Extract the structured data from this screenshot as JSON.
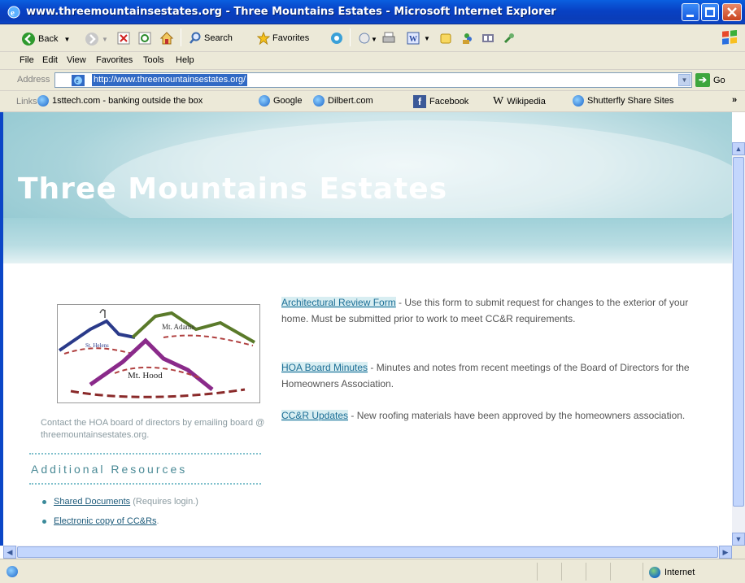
{
  "window": {
    "title": "www.threemountainsestates.org - Three Mountains Estates  - Microsoft Internet Explorer"
  },
  "toolbar": {
    "back_label": "Back",
    "search_label": "Search",
    "favorites_label": "Favorites"
  },
  "menu": [
    "File",
    "Edit",
    "View",
    "Favorites",
    "Tools",
    "Help"
  ],
  "address": {
    "label": "Address",
    "url": "http://www.threemountainsestates.org/",
    "go_label": "Go"
  },
  "links": {
    "label": "Links",
    "items": [
      "1sttech.com - banking outside the box",
      "Google",
      "Dilbert.com",
      "Facebook",
      "Wikipedia",
      "Shutterfly  Share Sites"
    ]
  },
  "page": {
    "site_title": "Three Mountains Estates",
    "logo_labels": [
      "St. Helens",
      "Mt. Adams",
      "Mt. Hood"
    ],
    "contact_text": "Contact the HOA board of directors by emailing board @ threemountainsestates.org.",
    "resources_heading": "Additional Resources",
    "resources": [
      {
        "link": "Shared Documents",
        "note": " (Requires login.)"
      },
      {
        "link": "Electronic copy of CC&Rs",
        "note": "."
      }
    ],
    "entries": [
      {
        "link": "Architectural Review Form",
        "text": " - Use this form to submit request for changes to the exterior of your home. Must be submitted prior to work to meet CC&R requirements."
      },
      {
        "link": "HOA Board Minutes",
        "text": " - Minutes and notes from recent meetings of the Board of Directors for the Homeowners Association."
      },
      {
        "link": "CC&R Updates",
        "text": " - New roofing materials have been approved by the homeowners association."
      }
    ]
  },
  "status": {
    "zone_label": "Internet"
  }
}
